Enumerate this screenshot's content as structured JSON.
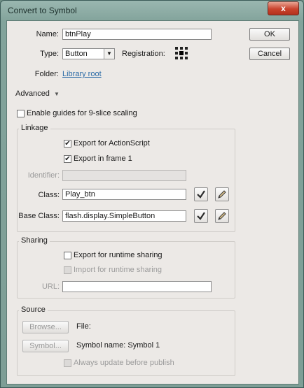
{
  "window": {
    "title": "Convert to Symbol",
    "close_glyph": "x"
  },
  "form": {
    "name_label": "Name:",
    "name_value": "btnPlay",
    "type_label": "Type:",
    "type_value": "Button",
    "registration_label": "Registration:",
    "folder_label": "Folder:",
    "folder_value": "Library root",
    "advanced_label": "Advanced",
    "nine_slice_label": "Enable guides for 9-slice scaling"
  },
  "buttons": {
    "ok": "OK",
    "cancel": "Cancel"
  },
  "linkage": {
    "title": "Linkage",
    "export_actionscript": "Export for ActionScript",
    "export_frame1": "Export in frame 1",
    "identifier_label": "Identifier:",
    "identifier_value": "",
    "class_label": "Class:",
    "class_value": "Play_btn",
    "base_class_label": "Base Class:",
    "base_class_value": "flash.display.SimpleButton"
  },
  "sharing": {
    "title": "Sharing",
    "export_runtime": "Export for runtime sharing",
    "import_runtime": "Import for runtime sharing",
    "url_label": "URL:",
    "url_value": ""
  },
  "source": {
    "title": "Source",
    "browse_label": "Browse...",
    "file_label": "File:",
    "symbol_button": "Symbol...",
    "symbol_name_text": "Symbol name: Symbol 1",
    "always_update": "Always update before publish"
  },
  "icons": {
    "check": "check-icon",
    "pencil": "pencil-icon",
    "dropdown": "chevron-down-icon",
    "registration": "registration-grid-icon"
  }
}
